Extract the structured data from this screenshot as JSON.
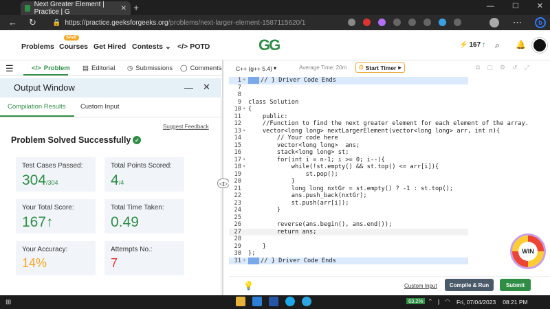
{
  "browser": {
    "tab_title": "Next Greater Element | Practice | G",
    "url_domain": "https://practice.geeksforgeeks.org",
    "url_path": "/problems/next-larger-element-1587115620/1"
  },
  "site_nav": {
    "problems": "Problems",
    "courses": "Courses",
    "courses_badge": "SAVE",
    "get_hired": "Get Hired",
    "contests": "Contests",
    "potd": "POTD",
    "logo": "GG",
    "streak": "167"
  },
  "problem_tabs": {
    "problem": "Problem",
    "editorial": "Editorial",
    "submissions": "Submissions",
    "comments": "Comments"
  },
  "output": {
    "title": "Output Window",
    "tab_compilation": "Compilation Results",
    "tab_custom": "Custom Input",
    "suggest_feedback": "Suggest Feedback",
    "status": "Problem Solved Successfully",
    "cards": {
      "test_cases_label": "Test Cases Passed:",
      "test_cases_value": "304",
      "test_cases_total": "/304",
      "points_label": "Total Points Scored:",
      "points_value": "4",
      "points_total": "/4",
      "score_label": "Your Total Score:",
      "score_value": "167",
      "time_label": "Total Time Taken:",
      "time_value": "0.49",
      "accuracy_label": "Your Accuracy:",
      "accuracy_value": "14%",
      "attempts_label": "Attempts No.:",
      "attempts_value": "7"
    }
  },
  "editor": {
    "language": "C++ (g++ 5.4)",
    "avg_time": "Average Time: 20m",
    "start_timer": "Start Timer",
    "custom_input": "Custom Input",
    "compile_run": "Compile & Run",
    "submit": "Submit",
    "win_badge": "WIN"
  },
  "code_lines": [
    {
      "n": "1",
      "fold": "+",
      "t": "// } Driver Code Ends",
      "style": "drv"
    },
    {
      "n": "7",
      "fold": "",
      "t": "",
      "style": ""
    },
    {
      "n": "8",
      "fold": "",
      "t": "",
      "style": ""
    },
    {
      "n": "9",
      "fold": "",
      "t": "class Solution",
      "style": ""
    },
    {
      "n": "10",
      "fold": "▾",
      "t": "{",
      "style": ""
    },
    {
      "n": "11",
      "fold": "",
      "t": "    public:",
      "style": "kw"
    },
    {
      "n": "12",
      "fold": "",
      "t": "    //Function to find the next greater element for each element of the array.",
      "style": "cm"
    },
    {
      "n": "13",
      "fold": "▾",
      "t": "    vector<long long> nextLargerElement(vector<long long> arr, int n){",
      "style": ""
    },
    {
      "n": "14",
      "fold": "",
      "t": "        // Your code here",
      "style": "cm"
    },
    {
      "n": "15",
      "fold": "",
      "t": "        vector<long long>  ans;",
      "style": ""
    },
    {
      "n": "16",
      "fold": "",
      "t": "        stack<long long> st;",
      "style": ""
    },
    {
      "n": "17",
      "fold": "▾",
      "t": "        for(int i = n-1; i >= 0; i--){",
      "style": ""
    },
    {
      "n": "18",
      "fold": "▾",
      "t": "            while(!st.empty() && st.top() <= arr[i]){",
      "style": ""
    },
    {
      "n": "19",
      "fold": "",
      "t": "                st.pop();",
      "style": ""
    },
    {
      "n": "20",
      "fold": "",
      "t": "            }",
      "style": ""
    },
    {
      "n": "21",
      "fold": "",
      "t": "            long long nxtGr = st.empty() ? -1 : st.top();",
      "style": ""
    },
    {
      "n": "22",
      "fold": "",
      "t": "            ans.push_back(nxtGr);",
      "style": ""
    },
    {
      "n": "23",
      "fold": "",
      "t": "            st.push(arr[i]);",
      "style": ""
    },
    {
      "n": "24",
      "fold": "",
      "t": "        }",
      "style": ""
    },
    {
      "n": "25",
      "fold": "",
      "t": "",
      "style": ""
    },
    {
      "n": "26",
      "fold": "",
      "t": "        reverse(ans.begin(), ans.end());",
      "style": ""
    },
    {
      "n": "27",
      "fold": "",
      "t": "        return ans;",
      "style": "cur"
    },
    {
      "n": "28",
      "fold": "",
      "t": "",
      "style": ""
    },
    {
      "n": "29",
      "fold": "",
      "t": "    }",
      "style": ""
    },
    {
      "n": "30",
      "fold": "",
      "t": "};",
      "style": ""
    },
    {
      "n": "31",
      "fold": "+",
      "t": "// } Driver Code Ends",
      "style": "drv"
    }
  ],
  "taskbar": {
    "battery": "63.2%",
    "date": "Fri, 07/04/2023",
    "time": "08:21 PM"
  },
  "colors": {
    "brand_green": "#2f8d46",
    "accuracy_orange": "#f5a623",
    "attempts_red": "#e53935"
  }
}
